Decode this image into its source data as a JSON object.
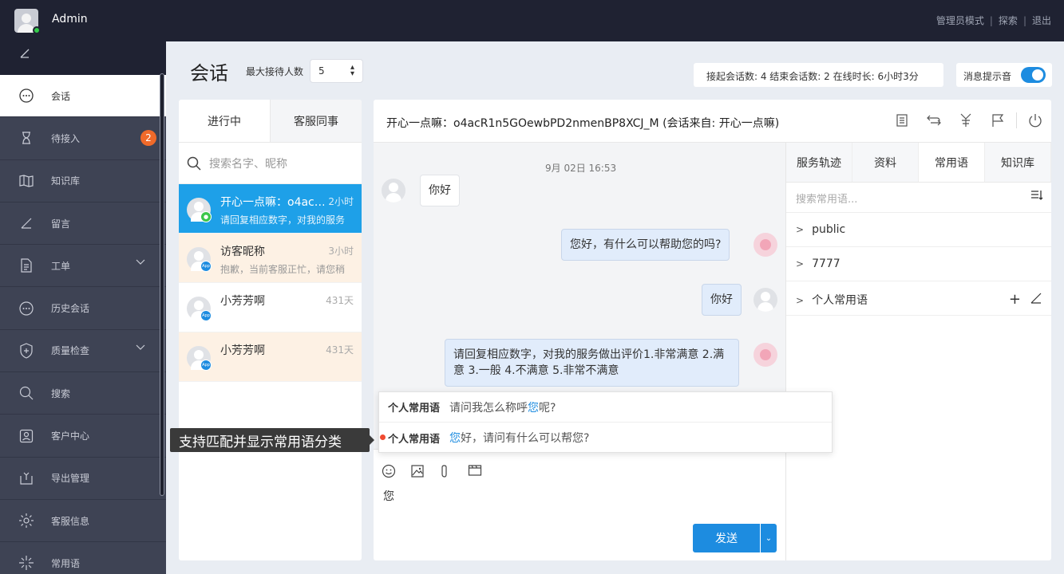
{
  "topbar": {
    "username": "Admin",
    "links": [
      "管理员模式",
      "探索",
      "退出"
    ]
  },
  "sidebar": {
    "items": [
      {
        "label": "会话",
        "icon": "chat-bubble-icon",
        "active": true
      },
      {
        "label": "待接入",
        "icon": "hourglass-icon",
        "badge": "2"
      },
      {
        "label": "知识库",
        "icon": "book-icon"
      },
      {
        "label": "留言",
        "icon": "pen-icon"
      },
      {
        "label": "工单",
        "icon": "document-icon",
        "expandable": true
      },
      {
        "label": "历史会话",
        "icon": "chat-history-icon"
      },
      {
        "label": "质量检查",
        "icon": "shield-plus-icon",
        "expandable": true
      },
      {
        "label": "搜索",
        "icon": "search-icon"
      },
      {
        "label": "客户中心",
        "icon": "contact-card-icon"
      },
      {
        "label": "导出管理",
        "icon": "export-icon"
      },
      {
        "label": "客服信息",
        "icon": "gear-icon"
      },
      {
        "label": "常用语",
        "icon": "sparkle-icon"
      }
    ]
  },
  "header": {
    "title": "会话",
    "max_label": "最大接待人数",
    "max_value": "5",
    "stats": "接起会话数: 4  结束会话数: 2  在线时长: 6小时3分",
    "sound_label": "消息提示音",
    "sound_on": true
  },
  "sessions": {
    "tabs": [
      "进行中",
      "客服同事"
    ],
    "search_placeholder": "搜索名字、昵称",
    "items": [
      {
        "name": "开心一点嘛：o4ac…",
        "time": "2小时",
        "preview": "请回复相应数字，对我的服务",
        "channel": "wechat",
        "state": "active"
      },
      {
        "name": "访客昵称",
        "time": "3小时",
        "preview": "抱歉，当前客服正忙，请您稍",
        "channel": "App",
        "state": "pending"
      },
      {
        "name": "小芳芳啊",
        "time": "431天",
        "preview": "",
        "channel": "App",
        "state": "normal"
      },
      {
        "name": "小芳芳啊",
        "time": "431天",
        "preview": "",
        "channel": "App",
        "state": "pending"
      }
    ]
  },
  "chat": {
    "title": "开心一点嘛：o4acR1n5GOewbPD2nmenBP8XCJ_M (会话来自: 开心一点嘛)",
    "header_icons": [
      "note-icon",
      "transfer-icon",
      "reward-icon",
      "flag-icon",
      "power-icon"
    ],
    "timestamp": "9月 02日 16:53",
    "messages": [
      {
        "from": "visitor",
        "text": "你好"
      },
      {
        "from": "agent",
        "text": "您好，有什么可以帮助您的吗?"
      },
      {
        "from": "agent",
        "text": "你好"
      },
      {
        "from": "agent",
        "text": "请回复相应数字，对我的服务做出评价1.非常满意 2.满意 3.一般 4.不满意 5.非常不满意"
      }
    ],
    "editor_text": "您",
    "send_label": "发送",
    "suggestions": [
      {
        "category": "个人常用语",
        "pre": "请问我怎么称呼",
        "match": "您",
        "post": "呢?"
      },
      {
        "category": "个人常用语",
        "pre": "",
        "match": "您",
        "post": "好，请问有什么可以帮您?"
      }
    ],
    "tooltip": "支持匹配并显示常用语分类"
  },
  "right_panel": {
    "tabs": [
      "服务轨迹",
      "资料",
      "常用语",
      "知识库"
    ],
    "selected_tab": "常用语",
    "search_placeholder": "搜索常用语...",
    "groups": [
      "public",
      "7777",
      "个人常用语"
    ]
  },
  "colors": {
    "accent": "#1d8ce0",
    "badge": "#f06a2a",
    "sidebar_bg": "#3e4354",
    "topbar_bg": "#1f2232"
  }
}
